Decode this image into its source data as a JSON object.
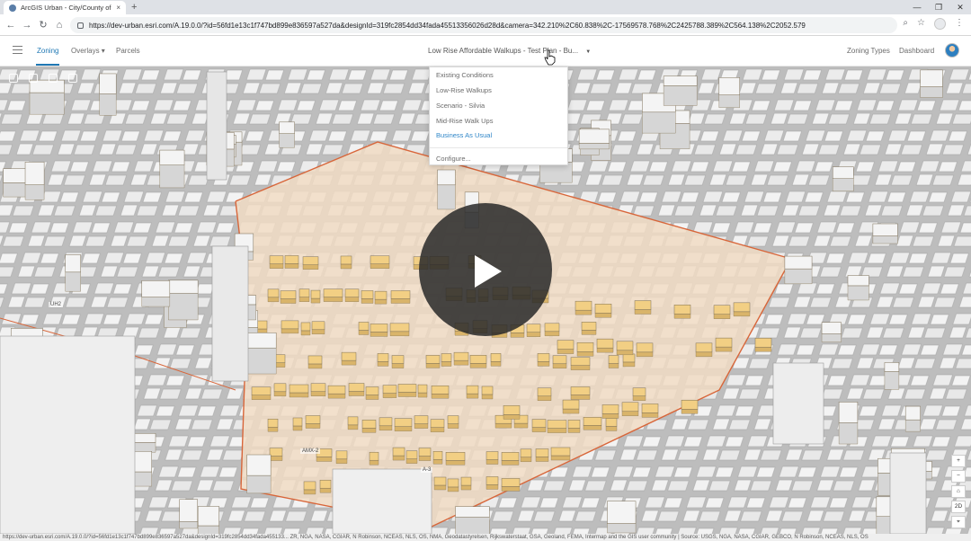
{
  "browser": {
    "tab_title": "ArcGIS Urban - City/County of H",
    "tab_close": "×",
    "new_tab": "+",
    "window_controls": [
      "—",
      "❐",
      "✕"
    ],
    "url": "https://dev-urban.esri.com/A.19.0.0/?id=56fd1e13c1f747bd899e836597a527da&designId=319fc2854dd34fada45513356026d28d&camera=342.210%2C60.838%2C-17569578.768%2C2425788.389%2C564.138%2C2052.579",
    "status_url": "https://dev-urban.esri.com/A.19.0.0/?id=56fd1e13c1f747bd899e836597a527da&designId=319fc2854dd34fada455133... ZR, NGA, NASA, CGIAR, N Robinson, NCEAS, NLS, OS, NMA, Geodatastyrelsen, Rijkswaterstaat, GSA, Geoland, FEMA, Intermap and the GIS user community | Source: USGS, NGA, NASA, CGIAR, GEBCO, N Robinson, NCEAS, NLS, OS"
  },
  "header": {
    "nav": [
      "Zoning",
      "Overlays",
      "Parcels"
    ],
    "overlays_caret": "▾",
    "design_selector": "Low Rise Affordable Walkups - Test Plan - Bu...",
    "design_caret": "▼",
    "right_links": [
      "Zoning Types",
      "Dashboard"
    ]
  },
  "dropdown": {
    "options": [
      "Existing Conditions",
      "Low-Rise Walkups",
      "Scenario - Silvia",
      "Mid-Rise Walk Ups",
      "Business As Usual"
    ],
    "selected": "Business As Usual",
    "configure": "Configure..."
  },
  "map": {
    "zone_labels": [
      "UH2",
      "AMX-2",
      "A-3"
    ],
    "controls": [
      "+",
      "−",
      "⌂",
      "2D",
      "⌖"
    ]
  },
  "colors": {
    "accent": "#1f78b4",
    "zone_fill": "#f2cf84",
    "plan_area": "#f1dcc4",
    "boundary": "#d8663a"
  }
}
